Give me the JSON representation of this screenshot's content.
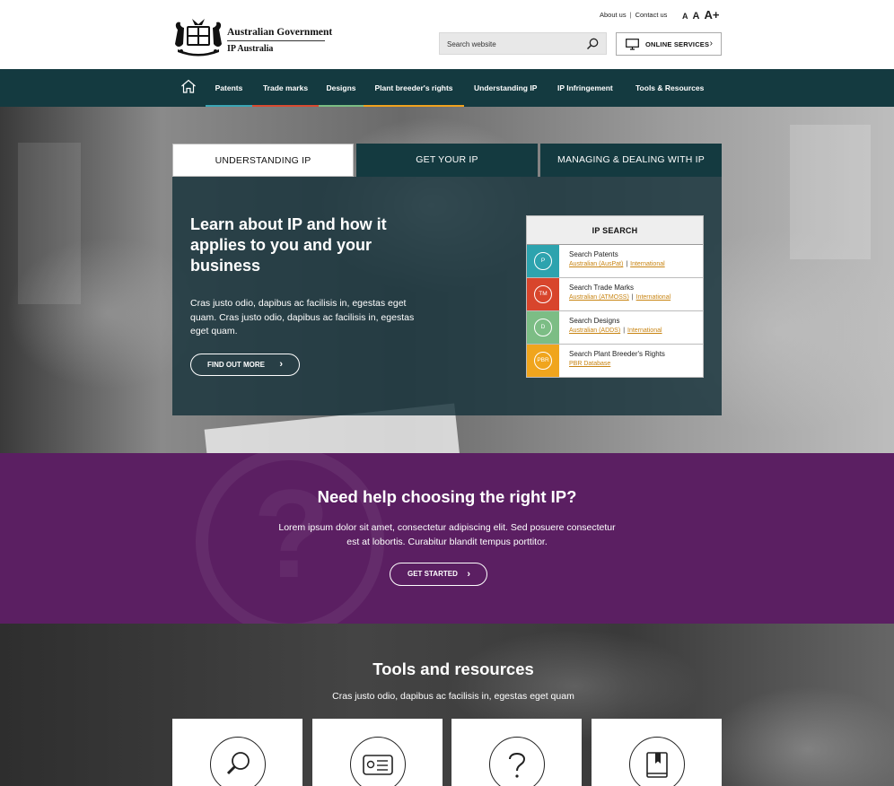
{
  "header": {
    "logo_line1": "Australian Government",
    "logo_line2": "IP Australia",
    "util_links": [
      "About us",
      "Contact us"
    ],
    "util_sep": "|",
    "font_sizes": [
      "A",
      "A",
      "A+"
    ],
    "search_placeholder": "Search website",
    "online_services": "ONLINE SERVICES",
    "chev": "›"
  },
  "nav": {
    "items": [
      {
        "label": "Patents",
        "color": "#3aa6b5"
      },
      {
        "label": "Trade marks",
        "color": "#d84b32"
      },
      {
        "label": "Designs",
        "color": "#7bbd83"
      },
      {
        "label": "Plant breeder's rights",
        "color": "#f0a21e"
      },
      {
        "label": "Understanding IP",
        "color": ""
      },
      {
        "label": "IP Infringement",
        "color": ""
      },
      {
        "label": "Tools & Resources",
        "color": ""
      }
    ]
  },
  "hero": {
    "tabs": [
      "UNDERSTANDING IP",
      "GET YOUR IP",
      "MANAGING & DEALING WITH IP"
    ],
    "title": "Learn about IP and how it applies to you and your business",
    "body": "Cras justo odio, dapibus ac facilisis in, egestas eget quam. Cras justo odio, dapibus ac facilisis in, egestas eget quam.",
    "button": "FIND OUT MORE",
    "ip_search": {
      "heading": "IP SEARCH",
      "rows": [
        {
          "badge": "P",
          "color": "#2da3ae",
          "title": "Search Patents",
          "link1": "Australian (AusPat)",
          "link2": "International"
        },
        {
          "badge": "TM",
          "color": "#d8452c",
          "title": "Search Trade Marks",
          "link1": "Australian (ATMOSS)",
          "link2": "International"
        },
        {
          "badge": "D",
          "color": "#7cbd85",
          "title": "Search Designs",
          "link1": "Australian (ADDS)",
          "link2": "International"
        },
        {
          "badge": "PBR",
          "color": "#f0a51d",
          "title": "Search Plant Breeder's Rights",
          "link1": "PBR Database",
          "link2": ""
        }
      ]
    }
  },
  "help": {
    "title": "Need help choosing the right IP?",
    "body": "Lorem ipsum dolor sit amet, consectetur adipiscing elit. Sed posuere consectetur est at lobortis. Curabitur blandit tempus porttitor.",
    "button": "GET STARTED"
  },
  "tools": {
    "title": "Tools and resources",
    "subtitle": "Cras justo odio, dapibus ac facilisis in, egestas eget quam",
    "cards": [
      {
        "icon": "magnifier-icon"
      },
      {
        "icon": "id-card-icon"
      },
      {
        "icon": "question-icon"
      },
      {
        "icon": "book-icon"
      }
    ]
  }
}
